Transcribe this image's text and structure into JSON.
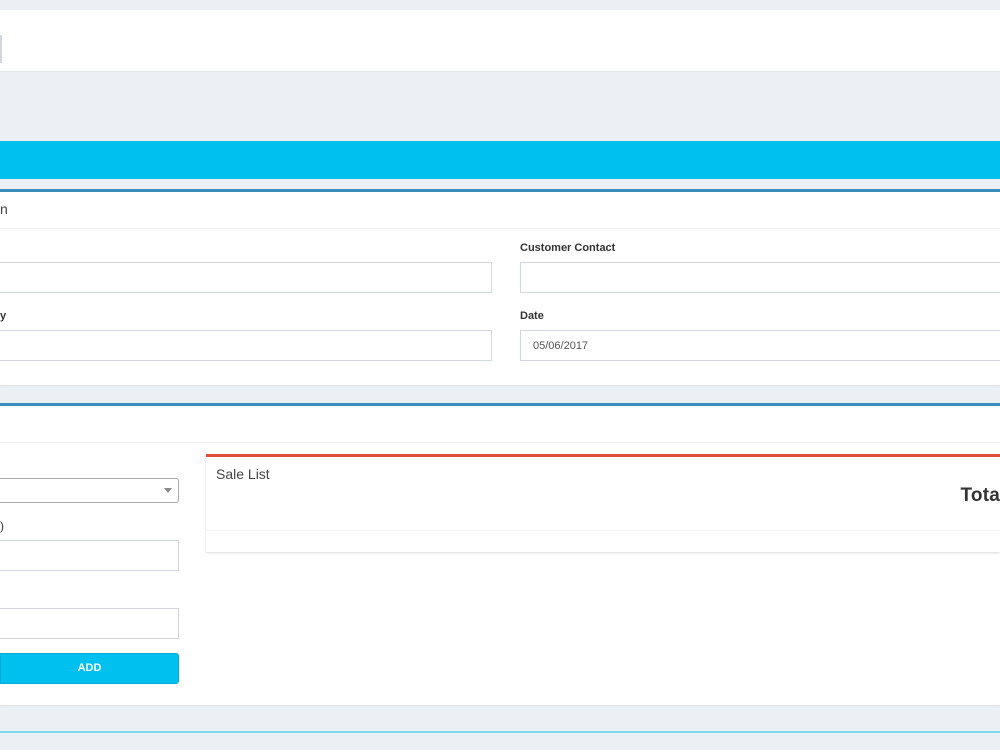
{
  "customer_section": {
    "title_fragment": "n",
    "name_label_fragment": "",
    "name_value": "",
    "contact_label": "Customer Contact",
    "contact_value": "",
    "city_label_fragment": "y",
    "city_value": "",
    "date_label": "Date",
    "date_value": "05/06/2017"
  },
  "sale_section": {
    "product_select_value": "",
    "price_label_fragment": ")",
    "price_value": "",
    "quantity_value": "",
    "add_button_label": "ADD",
    "sale_list": {
      "title": "Sale List",
      "total_heading_fragment": "Tota"
    }
  },
  "colors": {
    "info_bar": "#00c0ef",
    "primary_border": "#3c8dbc",
    "danger_border": "#dd4b39",
    "add_button": "#00c0ef"
  }
}
